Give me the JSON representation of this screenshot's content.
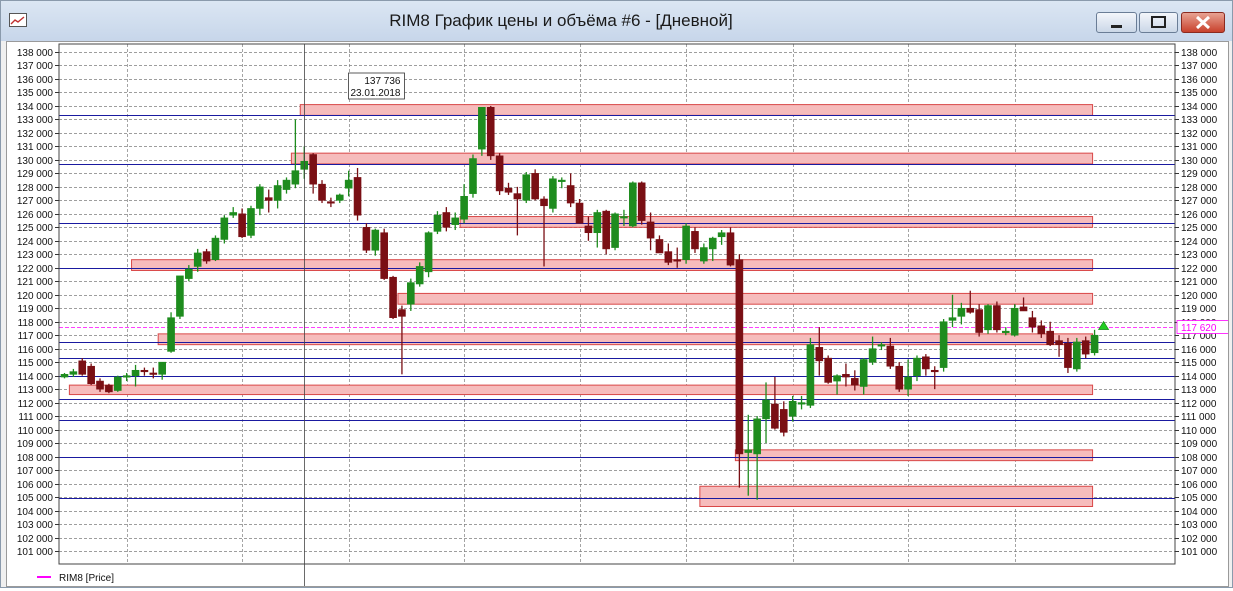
{
  "window": {
    "title": "RIM8 График цены и объёма #6 - [Дневной]"
  },
  "icons": {
    "app": "chart-window-icon",
    "minimize": "minimize-icon",
    "maximize": "maximize-icon",
    "close": "close-icon"
  },
  "colors": {
    "bull_candle": "#1e8c1e",
    "bear_candle": "#7a0f14",
    "zone_fill": "#f6bcbc",
    "zone_stroke": "#d94848",
    "level_line": "#1a1aa0",
    "last_price_line": "#ff00ff",
    "grid": "#7f7f7f"
  },
  "legend": {
    "label": "RIM8 [Price]"
  },
  "tooltip": {
    "value": "137 736",
    "date": "23.01.2018"
  },
  "last_price_label": "117 620",
  "chart_data": {
    "type": "candlestick",
    "series_name": "RIM8 [Price]",
    "ylim": [
      100000,
      138500
    ],
    "y_ticks": [
      101000,
      102000,
      103000,
      104000,
      105000,
      106000,
      107000,
      108000,
      109000,
      110000,
      111000,
      112000,
      113000,
      114000,
      115000,
      116000,
      117000,
      118000,
      119000,
      120000,
      121000,
      122000,
      123000,
      124000,
      125000,
      126000,
      127000,
      128000,
      129000,
      130000,
      131000,
      132000,
      133000,
      134000,
      135000,
      136000,
      137000,
      138000
    ],
    "y_tick_labels": [
      "101 000",
      "102 000",
      "103 000",
      "104 000",
      "105 000",
      "106 000",
      "107 000",
      "108 000",
      "109 000",
      "110 000",
      "111 000",
      "112 000",
      "113 000",
      "114 000",
      "115 000",
      "116 000",
      "117 000",
      "118 000",
      "119 000",
      "120 000",
      "121 000",
      "122 000",
      "123 000",
      "124 000",
      "125 000",
      "126 000",
      "127 000",
      "128 000",
      "129 000",
      "130 000",
      "131 000",
      "132 000",
      "133 000",
      "134 000",
      "135 000",
      "136 000",
      "137 000",
      "138 000"
    ],
    "candles": [
      {
        "o": 113900,
        "h": 114200,
        "l": 113800,
        "c": 114100
      },
      {
        "o": 114100,
        "h": 114500,
        "l": 113900,
        "c": 114300
      },
      {
        "o": 115100,
        "h": 115300,
        "l": 114000,
        "c": 114100
      },
      {
        "o": 114700,
        "h": 114900,
        "l": 113300,
        "c": 113400
      },
      {
        "o": 113600,
        "h": 113800,
        "l": 112800,
        "c": 113000
      },
      {
        "o": 113300,
        "h": 113400,
        "l": 112700,
        "c": 112800
      },
      {
        "o": 112900,
        "h": 114000,
        "l": 112800,
        "c": 113900
      },
      {
        "o": 113900,
        "h": 114200,
        "l": 113600,
        "c": 114000
      },
      {
        "o": 114000,
        "h": 114800,
        "l": 113200,
        "c": 114400
      },
      {
        "o": 114400,
        "h": 114600,
        "l": 114000,
        "c": 114300
      },
      {
        "o": 114200,
        "h": 114600,
        "l": 113800,
        "c": 114100
      },
      {
        "o": 114100,
        "h": 115000,
        "l": 113700,
        "c": 115000
      },
      {
        "o": 115800,
        "h": 118700,
        "l": 115700,
        "c": 118300
      },
      {
        "o": 118400,
        "h": 121300,
        "l": 118200,
        "c": 121400
      },
      {
        "o": 121200,
        "h": 122200,
        "l": 121000,
        "c": 121900
      },
      {
        "o": 122100,
        "h": 123400,
        "l": 121700,
        "c": 123100
      },
      {
        "o": 123200,
        "h": 123400,
        "l": 122300,
        "c": 122500
      },
      {
        "o": 122600,
        "h": 124400,
        "l": 122500,
        "c": 124200
      },
      {
        "o": 124100,
        "h": 125900,
        "l": 123800,
        "c": 125700
      },
      {
        "o": 125900,
        "h": 126500,
        "l": 125700,
        "c": 126100
      },
      {
        "o": 126000,
        "h": 126400,
        "l": 124200,
        "c": 124300
      },
      {
        "o": 124400,
        "h": 126600,
        "l": 124200,
        "c": 126400
      },
      {
        "o": 126400,
        "h": 128200,
        "l": 125900,
        "c": 128000
      },
      {
        "o": 127200,
        "h": 127800,
        "l": 126100,
        "c": 127000
      },
      {
        "o": 127000,
        "h": 128500,
        "l": 126400,
        "c": 128100
      },
      {
        "o": 127800,
        "h": 128700,
        "l": 127500,
        "c": 128500
      },
      {
        "o": 128200,
        "h": 133000,
        "l": 127900,
        "c": 129200
      },
      {
        "o": 129300,
        "h": 131000,
        "l": 128600,
        "c": 129900
      },
      {
        "o": 130400,
        "h": 130500,
        "l": 127500,
        "c": 128200
      },
      {
        "o": 128200,
        "h": 128500,
        "l": 126800,
        "c": 127000
      },
      {
        "o": 126900,
        "h": 127200,
        "l": 126500,
        "c": 126800
      },
      {
        "o": 127000,
        "h": 127500,
        "l": 126800,
        "c": 127400
      },
      {
        "o": 127900,
        "h": 129200,
        "l": 127300,
        "c": 128500
      },
      {
        "o": 128700,
        "h": 129400,
        "l": 125500,
        "c": 125900
      },
      {
        "o": 125000,
        "h": 125300,
        "l": 123100,
        "c": 123300
      },
      {
        "o": 123300,
        "h": 124900,
        "l": 122900,
        "c": 124800
      },
      {
        "o": 124600,
        "h": 124900,
        "l": 121100,
        "c": 121200
      },
      {
        "o": 121300,
        "h": 121400,
        "l": 118200,
        "c": 118300
      },
      {
        "o": 118900,
        "h": 119200,
        "l": 114100,
        "c": 118400
      },
      {
        "o": 119300,
        "h": 121200,
        "l": 118800,
        "c": 120900
      },
      {
        "o": 120800,
        "h": 122400,
        "l": 120600,
        "c": 122100
      },
      {
        "o": 121700,
        "h": 124700,
        "l": 121300,
        "c": 124600
      },
      {
        "o": 124700,
        "h": 126200,
        "l": 124500,
        "c": 125900
      },
      {
        "o": 126100,
        "h": 126500,
        "l": 124700,
        "c": 125000
      },
      {
        "o": 125200,
        "h": 126100,
        "l": 124800,
        "c": 125700
      },
      {
        "o": 125600,
        "h": 128200,
        "l": 125300,
        "c": 127300
      },
      {
        "o": 127500,
        "h": 130400,
        "l": 127200,
        "c": 130100
      },
      {
        "o": 130800,
        "h": 133900,
        "l": 130300,
        "c": 133900
      },
      {
        "o": 133900,
        "h": 134000,
        "l": 130000,
        "c": 130300
      },
      {
        "o": 130300,
        "h": 130500,
        "l": 127400,
        "c": 127700
      },
      {
        "o": 127900,
        "h": 128300,
        "l": 127400,
        "c": 127600
      },
      {
        "o": 127500,
        "h": 128000,
        "l": 124400,
        "c": 127100
      },
      {
        "o": 127000,
        "h": 129100,
        "l": 126800,
        "c": 128900
      },
      {
        "o": 129000,
        "h": 129300,
        "l": 127000,
        "c": 127100
      },
      {
        "o": 127100,
        "h": 127300,
        "l": 122100,
        "c": 126600
      },
      {
        "o": 126400,
        "h": 128800,
        "l": 126100,
        "c": 128600
      },
      {
        "o": 128500,
        "h": 128700,
        "l": 127900,
        "c": 128500
      },
      {
        "o": 128100,
        "h": 129000,
        "l": 126500,
        "c": 126800
      },
      {
        "o": 126800,
        "h": 127100,
        "l": 125300,
        "c": 125300
      },
      {
        "o": 125100,
        "h": 125800,
        "l": 124000,
        "c": 124600
      },
      {
        "o": 124600,
        "h": 126300,
        "l": 123500,
        "c": 126100
      },
      {
        "o": 126200,
        "h": 126300,
        "l": 123000,
        "c": 123400
      },
      {
        "o": 123500,
        "h": 126100,
        "l": 123300,
        "c": 126000
      },
      {
        "o": 125800,
        "h": 126300,
        "l": 125100,
        "c": 125800
      },
      {
        "o": 125100,
        "h": 128400,
        "l": 125000,
        "c": 128300
      },
      {
        "o": 128300,
        "h": 128400,
        "l": 125200,
        "c": 125500
      },
      {
        "o": 125400,
        "h": 126100,
        "l": 123300,
        "c": 124200
      },
      {
        "o": 124100,
        "h": 124400,
        "l": 123300,
        "c": 123100
      },
      {
        "o": 123200,
        "h": 123800,
        "l": 122200,
        "c": 122400
      },
      {
        "o": 122600,
        "h": 123500,
        "l": 122000,
        "c": 122500
      },
      {
        "o": 122600,
        "h": 125300,
        "l": 122300,
        "c": 125100
      },
      {
        "o": 124700,
        "h": 125000,
        "l": 123100,
        "c": 123400
      },
      {
        "o": 122500,
        "h": 123800,
        "l": 122300,
        "c": 123500
      },
      {
        "o": 123400,
        "h": 124300,
        "l": 122500,
        "c": 124200
      },
      {
        "o": 124300,
        "h": 124800,
        "l": 123700,
        "c": 124600
      },
      {
        "o": 124600,
        "h": 125000,
        "l": 122100,
        "c": 122200
      },
      {
        "o": 122600,
        "h": 123000,
        "l": 105700,
        "c": 108200
      },
      {
        "o": 108300,
        "h": 111100,
        "l": 105100,
        "c": 108500
      },
      {
        "o": 108200,
        "h": 111000,
        "l": 104800,
        "c": 110800
      },
      {
        "o": 110800,
        "h": 113500,
        "l": 109000,
        "c": 112200
      },
      {
        "o": 111900,
        "h": 113900,
        "l": 110000,
        "c": 110100
      },
      {
        "o": 111500,
        "h": 112100,
        "l": 109500,
        "c": 109800
      },
      {
        "o": 111000,
        "h": 112500,
        "l": 110600,
        "c": 112100
      },
      {
        "o": 111900,
        "h": 112500,
        "l": 111500,
        "c": 112000
      },
      {
        "o": 111800,
        "h": 116800,
        "l": 111600,
        "c": 116300
      },
      {
        "o": 116100,
        "h": 117600,
        "l": 114000,
        "c": 115100
      },
      {
        "o": 115300,
        "h": 115500,
        "l": 113400,
        "c": 113500
      },
      {
        "o": 113600,
        "h": 114100,
        "l": 112600,
        "c": 114000
      },
      {
        "o": 114100,
        "h": 114900,
        "l": 113200,
        "c": 113900
      },
      {
        "o": 113800,
        "h": 114400,
        "l": 112900,
        "c": 113300
      },
      {
        "o": 113200,
        "h": 115300,
        "l": 112600,
        "c": 115200
      },
      {
        "o": 115000,
        "h": 116900,
        "l": 114800,
        "c": 116000
      },
      {
        "o": 116200,
        "h": 116500,
        "l": 115900,
        "c": 116300
      },
      {
        "o": 116200,
        "h": 116800,
        "l": 114500,
        "c": 114700
      },
      {
        "o": 114700,
        "h": 115000,
        "l": 112800,
        "c": 113000
      },
      {
        "o": 113000,
        "h": 115200,
        "l": 112500,
        "c": 113900
      },
      {
        "o": 114000,
        "h": 115500,
        "l": 113600,
        "c": 115300
      },
      {
        "o": 115400,
        "h": 115600,
        "l": 114000,
        "c": 114500
      },
      {
        "o": 114400,
        "h": 114700,
        "l": 113000,
        "c": 114300
      },
      {
        "o": 114600,
        "h": 118200,
        "l": 114300,
        "c": 118000
      },
      {
        "o": 118100,
        "h": 120000,
        "l": 117600,
        "c": 118300
      },
      {
        "o": 118400,
        "h": 119400,
        "l": 117800,
        "c": 119000
      },
      {
        "o": 119000,
        "h": 120300,
        "l": 118600,
        "c": 118700
      },
      {
        "o": 118900,
        "h": 119300,
        "l": 116900,
        "c": 117200
      },
      {
        "o": 117400,
        "h": 119300,
        "l": 117100,
        "c": 119200
      },
      {
        "o": 119200,
        "h": 119500,
        "l": 117200,
        "c": 117400
      },
      {
        "o": 117300,
        "h": 117600,
        "l": 117000,
        "c": 117300
      },
      {
        "o": 117000,
        "h": 119300,
        "l": 116900,
        "c": 119000
      },
      {
        "o": 119100,
        "h": 119800,
        "l": 118800,
        "c": 118800
      },
      {
        "o": 118300,
        "h": 118800,
        "l": 117200,
        "c": 117600
      },
      {
        "o": 117700,
        "h": 118100,
        "l": 116800,
        "c": 117100
      },
      {
        "o": 117300,
        "h": 118000,
        "l": 116200,
        "c": 116300
      },
      {
        "o": 116600,
        "h": 117000,
        "l": 115400,
        "c": 116300
      },
      {
        "o": 116400,
        "h": 116800,
        "l": 114200,
        "c": 114600
      },
      {
        "o": 114500,
        "h": 116800,
        "l": 114300,
        "c": 116500
      },
      {
        "o": 116600,
        "h": 116900,
        "l": 115300,
        "c": 115600
      },
      {
        "o": 115700,
        "h": 117400,
        "l": 115500,
        "c": 117000
      }
    ],
    "zones": [
      {
        "from": 133300,
        "to": 134100,
        "x_start_index": 27
      },
      {
        "from": 129700,
        "to": 130500,
        "x_start_index": 26
      },
      {
        "from": 125000,
        "to": 125800,
        "x_start_index": 45
      },
      {
        "from": 121800,
        "to": 122600,
        "x_start_index": 8
      },
      {
        "from": 119300,
        "to": 120100,
        "x_start_index": 38
      },
      {
        "from": 116300,
        "to": 117100,
        "x_start_index": 11
      },
      {
        "from": 112600,
        "to": 113300,
        "x_start_index": 1
      },
      {
        "from": 107700,
        "to": 108500,
        "x_start_index": 76
      },
      {
        "from": 104300,
        "to": 105800,
        "x_start_index": 72
      }
    ],
    "zone_right_extension_index": 116,
    "horizontal_levels": [
      133300,
      129700,
      125300,
      122000,
      116500,
      115300,
      114000,
      112300,
      110700,
      108000,
      104900
    ],
    "last_price": 117620,
    "crosshair": {
      "candle_index": 27,
      "price": 137736,
      "date": "23.01.2018"
    },
    "x_grid_positions": [
      7,
      20,
      32,
      45,
      58,
      70,
      82,
      95,
      107
    ],
    "grid": true
  }
}
